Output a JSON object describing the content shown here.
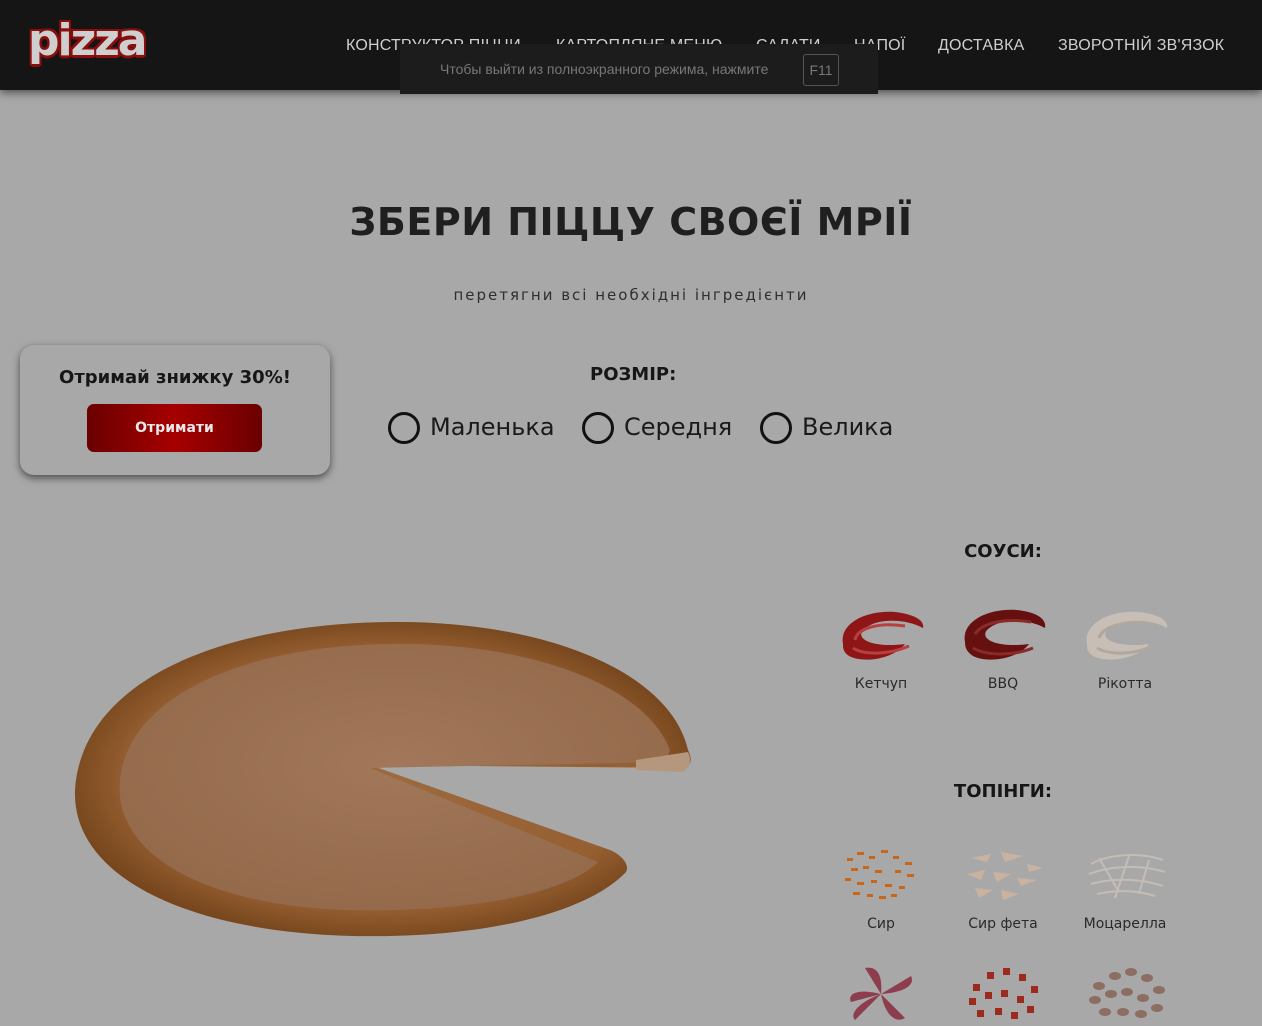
{
  "header": {
    "logo_text": "pizza",
    "nav": [
      {
        "label": "КОНСТРУКТОР ПІЦЦИ"
      },
      {
        "label": "КАРТОПЛЯНЕ МЕНЮ"
      },
      {
        "label": "САЛАТИ"
      },
      {
        "label": "НАПОЇ"
      },
      {
        "label": "ДОСТАВКА"
      },
      {
        "label": "ЗВОРОТНІЙ ЗВ'ЯЗОК"
      }
    ]
  },
  "fullscreen_hint": {
    "text": "Чтобы выйти из полноэкранного режима, нажмите",
    "key": "F11"
  },
  "hero": {
    "title": "ЗБЕРИ ПІЦЦУ СВОЄЇ МРІЇ",
    "subtitle": "перетягни всі необхідні інгредієнти"
  },
  "promo": {
    "title": "Отримай знижку 30%!",
    "button_label": "Отримати"
  },
  "size": {
    "label": "РОЗМІР:",
    "options": [
      {
        "label": "Маленька"
      },
      {
        "label": "Середня"
      },
      {
        "label": "Велика"
      }
    ]
  },
  "sauces": {
    "title": "СОУСИ:",
    "items": [
      {
        "name": "Кетчуп",
        "icon": "ketchup-sauce-icon",
        "color": "#9a1a1a"
      },
      {
        "name": "BBQ",
        "icon": "bbq-sauce-icon",
        "color": "#6e1212"
      },
      {
        "name": "Рікотта",
        "icon": "ricotta-sauce-icon",
        "color": "#cdc6be"
      }
    ]
  },
  "toppings": {
    "title": "ТОПІНГИ:",
    "items": [
      {
        "name": "Сир",
        "icon": "cheese-icon",
        "color": "#c8661a"
      },
      {
        "name": "Сир фета",
        "icon": "feta-cheese-icon",
        "color": "#c9b3a0"
      },
      {
        "name": "Моцарелла",
        "icon": "mozzarella-icon",
        "color": "#c4bdb5"
      },
      {
        "name": "",
        "icon": "salami-icon",
        "color": "#8e3d4e"
      },
      {
        "name": "",
        "icon": "tomato-icon",
        "color": "#9c2a1e"
      },
      {
        "name": "",
        "icon": "mushroom-icon",
        "color": "#8d6e63"
      }
    ]
  },
  "colors": {
    "header_bg": "#151515",
    "page_overlay": "#a8a8a8",
    "accent_red": "#a60000"
  }
}
